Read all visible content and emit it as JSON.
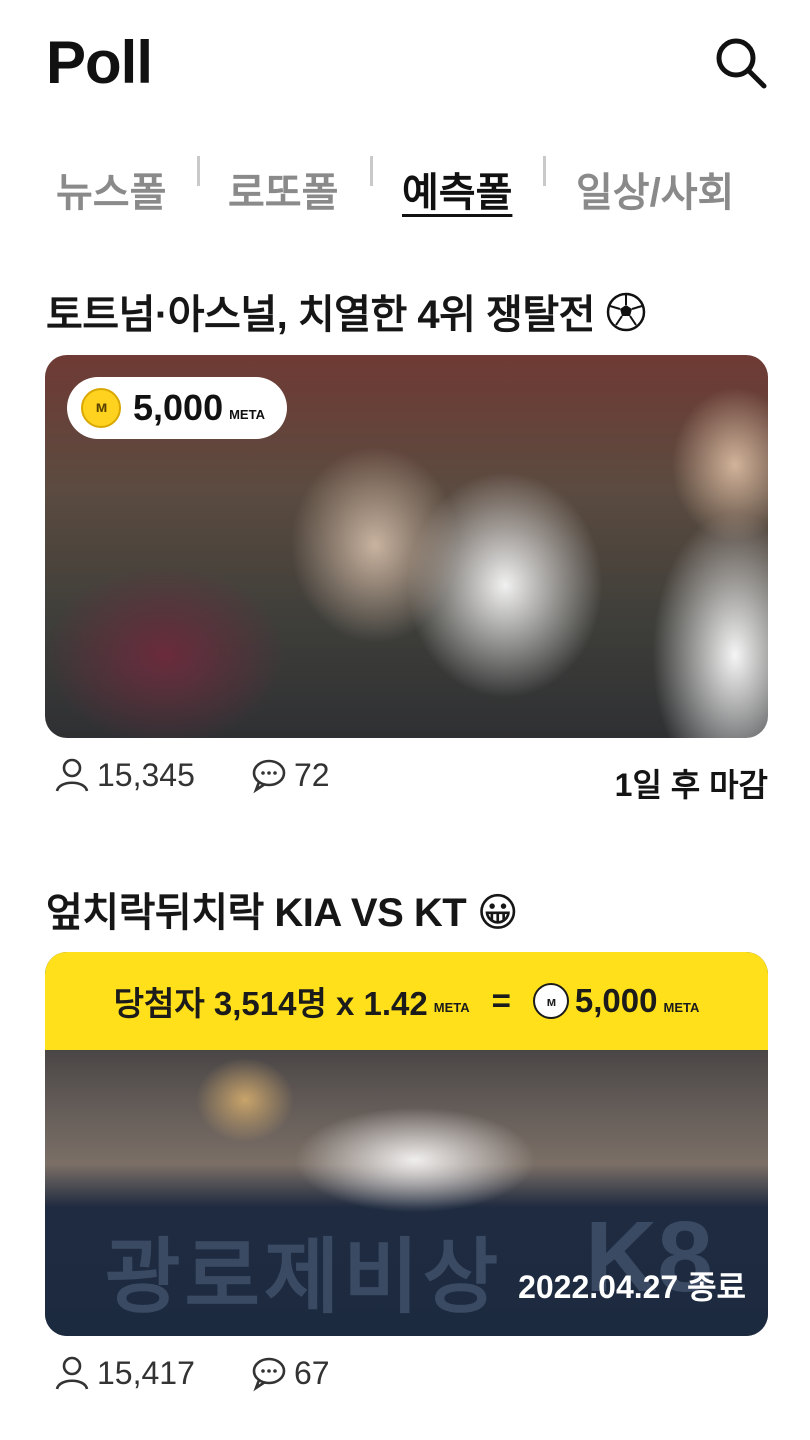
{
  "header": {
    "title": "Poll",
    "search_icon": "search-icon"
  },
  "tabs": [
    {
      "label": "뉴스폴",
      "active": false
    },
    {
      "label": "로또폴",
      "active": false
    },
    {
      "label": "예측폴",
      "active": true
    },
    {
      "label": "일상/사회",
      "active": false
    }
  ],
  "polls": [
    {
      "title": "토트넘·아스널, 치열한 4위 쟁탈전",
      "title_emoji": "soccer-ball",
      "reward": {
        "amount": "5,000",
        "unit": "META",
        "coin_glyph": "ᴍ"
      },
      "participants": "15,345",
      "comments": "72",
      "deadline": "1일 후 마감"
    },
    {
      "title": "엎치락뒤치락 KIA VS KT",
      "title_emoji": "😀",
      "result": {
        "winners_text": "당첨자 3,514명 x 1.42",
        "unit": "META",
        "equals": "=",
        "total": "5,000",
        "total_unit": "META",
        "coin_glyph": "ᴍ"
      },
      "board_text": "광로제비상",
      "board_k8": "K8",
      "ended": "2022.04.27 종료",
      "participants": "15,417",
      "comments": "67"
    }
  ],
  "colors": {
    "accent": "#ffe01b",
    "coin": "#ffd21f",
    "text": "#1a1a1a",
    "muted": "#8a8a8a"
  }
}
